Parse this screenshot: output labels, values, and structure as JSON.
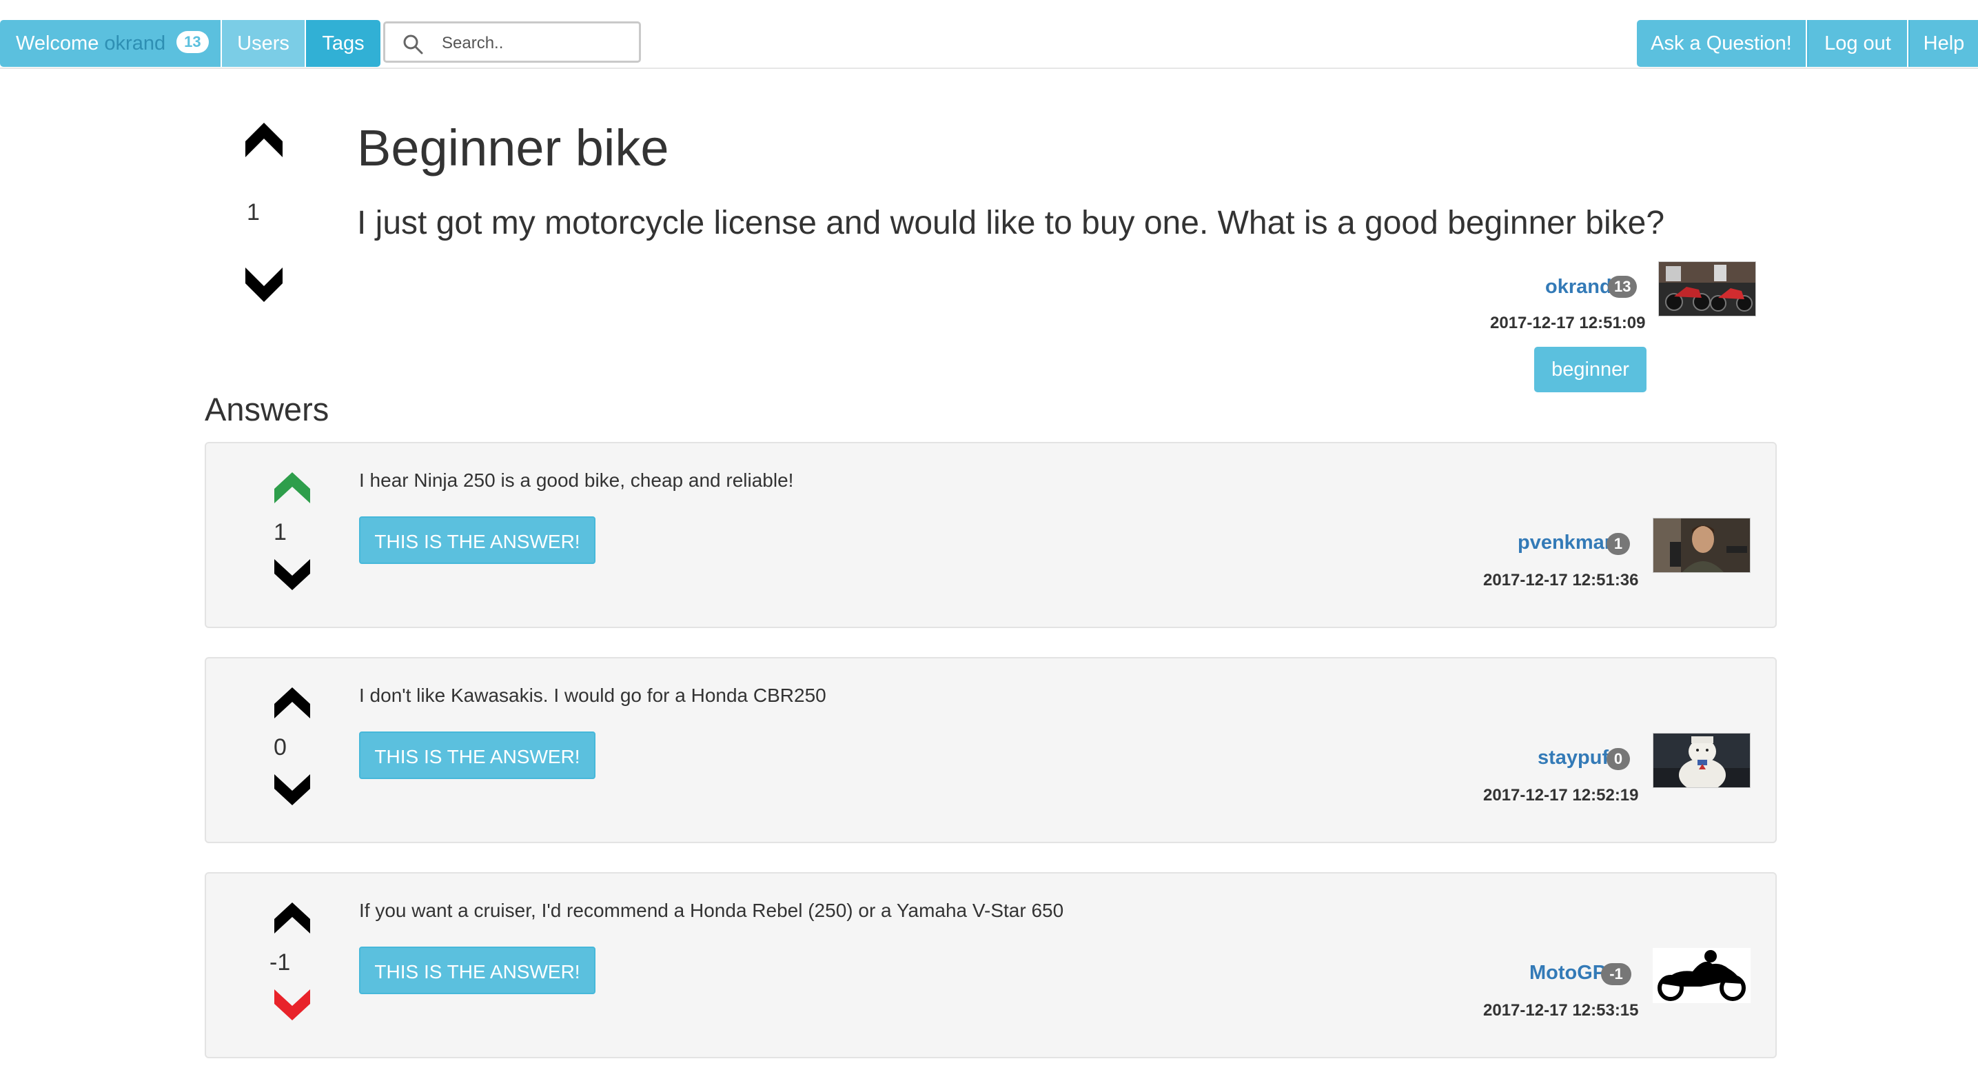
{
  "navbar": {
    "welcome_label": "Welcome",
    "welcome_user": "okrand",
    "welcome_badge": "13",
    "users_label": "Users",
    "tags_label": "Tags",
    "search_placeholder": "Search..",
    "ask_label": "Ask a Question!",
    "logout_label": "Log out",
    "help_label": "Help"
  },
  "question": {
    "votes": "1",
    "title": "Beginner bike",
    "body": "I just got my motorcycle license and would like to buy one. What is a good beginner bike?",
    "author": "okrand",
    "author_rep": "13",
    "timestamp": "2017-12-17 12:51:09",
    "tags": [
      "beginner"
    ]
  },
  "answers_heading": "Answers",
  "accept_label": "THIS IS THE ANSWER!",
  "answers": [
    {
      "text": "I hear Ninja 250 is a good bike, cheap and reliable!",
      "votes": "1",
      "vote_state": "up",
      "author": "pvenkman",
      "author_rep": "1",
      "timestamp": "2017-12-17 12:51:36"
    },
    {
      "text": "I don't like Kawasakis. I would go for a Honda CBR250",
      "votes": "0",
      "vote_state": "none",
      "author": "staypuft",
      "author_rep": "0",
      "timestamp": "2017-12-17 12:52:19"
    },
    {
      "text": "If you want a cruiser, I'd recommend a Honda Rebel (250) or a Yamaha V-Star 650",
      "votes": "-1",
      "vote_state": "down",
      "author": "MotoGP",
      "author_rep": "-1",
      "timestamp": "2017-12-17 12:53:15"
    }
  ],
  "colors": {
    "accent": "#5bc0de",
    "link": "#337ab7",
    "upvote_active": "#2e9e4b",
    "downvote_active": "#e8232a",
    "vote_neutral": "#000000",
    "badge": "#777777"
  }
}
